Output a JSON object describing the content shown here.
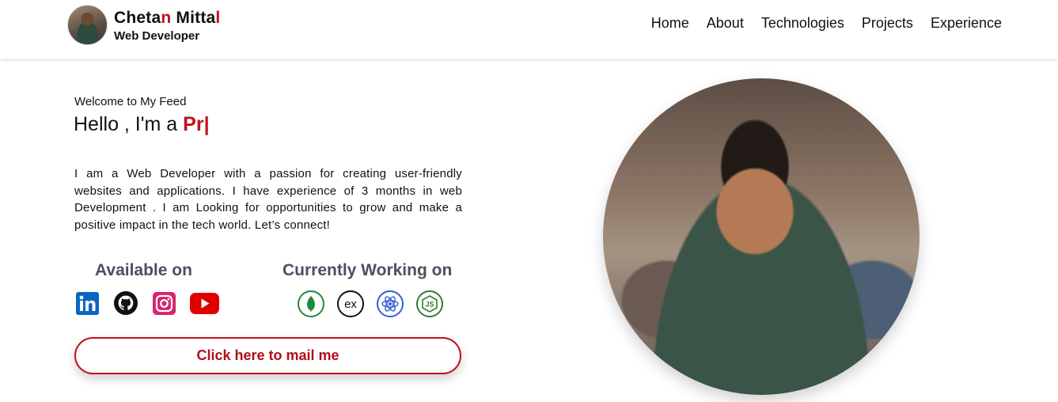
{
  "header": {
    "name_main": "Cheta",
    "name_accent_1": "n",
    "name_mid": " Mitta",
    "name_accent_2": "l",
    "role": "Web Developer",
    "nav": [
      "Home",
      "About",
      "Technologies",
      "Projects",
      "Experience"
    ]
  },
  "hero": {
    "welcome": "Welcome to My Feed",
    "greeting": "Hello , I'm a ",
    "typed": "Pr",
    "cursor": "|",
    "bio": "I am a Web Developer with a passion for creating user-friendly websites and applications. I have experience of 3 months in web Development . I am Looking for opportunities to grow and make a positive impact in the tech world. Let’s connect!",
    "available_title": "Available on",
    "working_title": "Currently Working on",
    "mail_button": "Click here to mail me"
  },
  "icons": {
    "social": [
      "linkedin-icon",
      "github-icon",
      "instagram-icon",
      "youtube-icon"
    ],
    "tech": [
      "mongodb-icon",
      "express-icon",
      "react-icon",
      "nodejs-icon"
    ],
    "tech_express_text": "ex",
    "tech_node_text": "JS"
  },
  "colors": {
    "accent": "#c0111b",
    "heading_gray": "#4a5060",
    "linkedin": "#0a66c2",
    "instagram": "#d6246e",
    "youtube": "#e00000",
    "mongodb": "#1e8a3c",
    "react": "#2f5fd8",
    "node": "#2e7d32"
  }
}
